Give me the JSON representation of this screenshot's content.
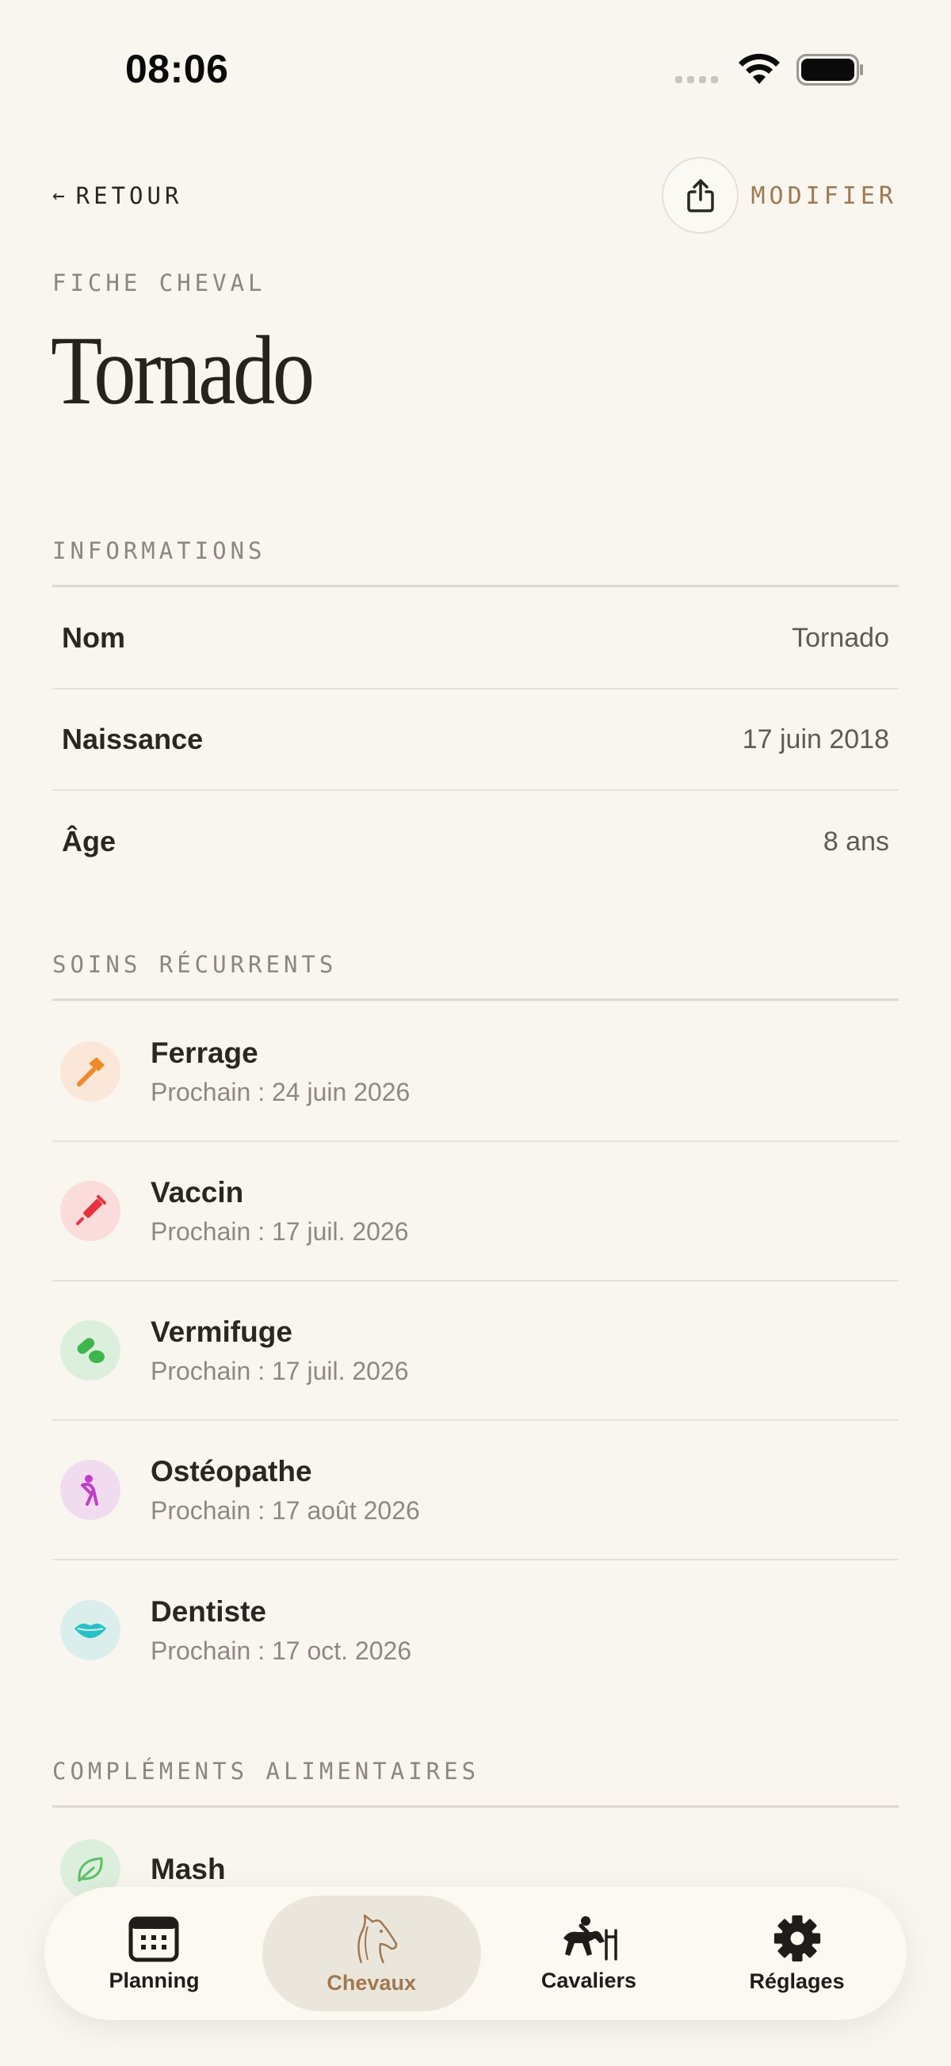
{
  "status_bar": {
    "time": "08:06"
  },
  "nav": {
    "back_label": "RETOUR",
    "back_arrow": "←",
    "modify_label": "MODIFIER"
  },
  "header": {
    "eyebrow": "FICHE CHEVAL",
    "title": "Tornado"
  },
  "info": {
    "heading": "INFORMATIONS",
    "rows": [
      {
        "label": "Nom",
        "value": "Tornado"
      },
      {
        "label": "Naissance",
        "value": "17 juin 2018"
      },
      {
        "label": "Âge",
        "value": "8 ans"
      }
    ]
  },
  "care": {
    "heading": "SOINS RÉCURRENTS",
    "items": [
      {
        "name": "Ferrage",
        "next": "Prochain : 24 juin 2026",
        "icon": "hammer-icon",
        "color": "#f0892a",
        "bg": "#fbe7d8"
      },
      {
        "name": "Vaccin",
        "next": "Prochain : 17 juil. 2026",
        "icon": "syringe-icon",
        "color": "#e8333f",
        "bg": "#fadcda"
      },
      {
        "name": "Vermifuge",
        "next": "Prochain : 17 juil. 2026",
        "icon": "pills-icon",
        "color": "#3fb54e",
        "bg": "#dcefdc"
      },
      {
        "name": "Ostéopathe",
        "next": "Prochain : 17 août 2026",
        "icon": "stretch-figure-icon",
        "color": "#c43cc9",
        "bg": "#f1dcef"
      },
      {
        "name": "Dentiste",
        "next": "Prochain : 17 oct. 2026",
        "icon": "lips-icon",
        "color": "#28c0c8",
        "bg": "#daeeec"
      }
    ]
  },
  "supplements": {
    "heading": "COMPLÉMENTS ALIMENTAIRES",
    "items": [
      {
        "name": "Mash",
        "icon": "leaf-icon",
        "color": "#5cbf6a",
        "bg": "#dcefdc"
      }
    ]
  },
  "tab_bar": {
    "tabs": [
      {
        "label": "Planning",
        "icon": "calendar-icon",
        "active": false
      },
      {
        "label": "Chevaux",
        "icon": "horse-head-icon",
        "active": true
      },
      {
        "label": "Cavaliers",
        "icon": "rider-jumping-icon",
        "active": false
      },
      {
        "label": "Réglages",
        "icon": "gear-icon",
        "active": false
      }
    ]
  },
  "colors": {
    "background": "#f9f6f0",
    "accent": "#a07850",
    "muted": "#8b8680"
  }
}
